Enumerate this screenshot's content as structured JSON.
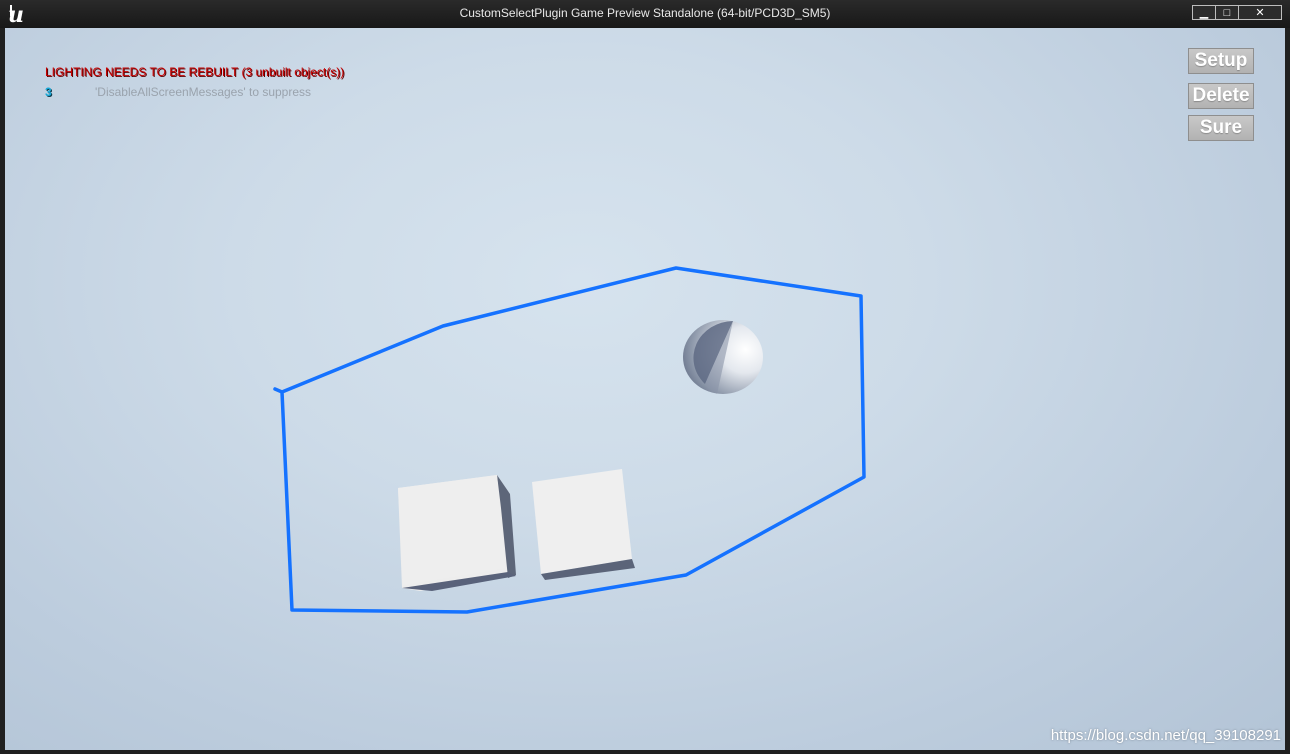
{
  "window": {
    "title": "CustomSelectPlugin Game Preview Standalone (64-bit/PCD3D_SM5)",
    "controls": {
      "minimize": "▁",
      "maximize": "□",
      "close": "✕"
    }
  },
  "messages": {
    "lighting": "LIGHTING NEEDS TO BE REBUILT (3 unbuilt object(s))",
    "count": "3",
    "suppress": "'DisableAllScreenMessages' to suppress"
  },
  "buttons": {
    "setup": "Setup",
    "delete": "Delete",
    "sure": "Sure"
  },
  "scene": {
    "selection_color": "#1572ff",
    "objects": [
      "cube",
      "cube",
      "sphere"
    ]
  },
  "watermark": "https://blog.csdn.net/qq_39108291",
  "colors": {
    "lighting_text": "#c80000",
    "count_text": "#17a8d8",
    "suppress_text": "#9aa3ad"
  }
}
